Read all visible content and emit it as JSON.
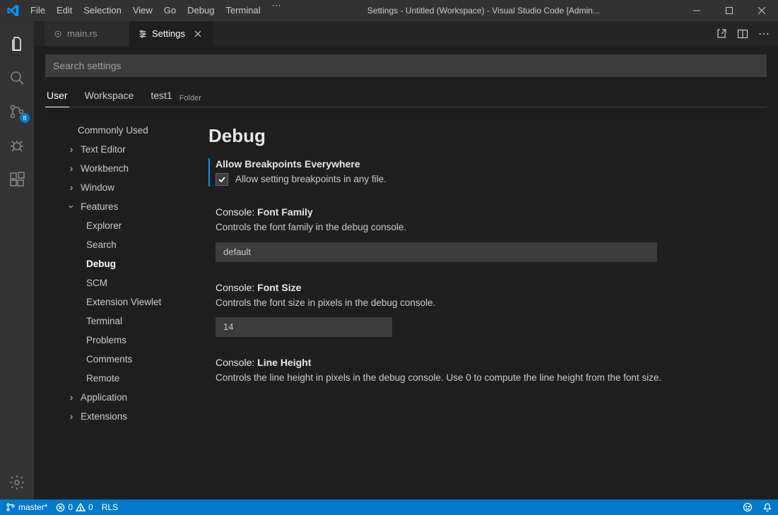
{
  "titlebar": {
    "menu": [
      "File",
      "Edit",
      "Selection",
      "View",
      "Go",
      "Debug",
      "Terminal"
    ],
    "title": "Settings - Untitled (Workspace) - Visual Studio Code [Admin..."
  },
  "activitybar": {
    "badge": "8"
  },
  "tabs": {
    "main": "main.rs",
    "settings": "Settings"
  },
  "search": {
    "placeholder": "Search settings"
  },
  "scope": {
    "user": "User",
    "workspace": "Workspace",
    "folder_name": "test1",
    "folder_label": "Folder"
  },
  "toc": {
    "commonly_used": "Commonly Used",
    "text_editor": "Text Editor",
    "workbench": "Workbench",
    "window": "Window",
    "features": "Features",
    "explorer": "Explorer",
    "search": "Search",
    "debug": "Debug",
    "scm": "SCM",
    "extension_viewlet": "Extension Viewlet",
    "terminal": "Terminal",
    "problems": "Problems",
    "comments": "Comments",
    "remote": "Remote",
    "application": "Application",
    "extensions": "Extensions"
  },
  "content": {
    "section": "Debug",
    "allow_bp": {
      "label": "Allow Breakpoints Everywhere",
      "desc": "Allow setting breakpoints in any file."
    },
    "font_family": {
      "scope": "Console: ",
      "name": "Font Family",
      "desc": "Controls the font family in the debug console.",
      "value": "default"
    },
    "font_size": {
      "scope": "Console: ",
      "name": "Font Size",
      "desc": "Controls the font size in pixels in the debug console.",
      "value": "14"
    },
    "line_height": {
      "scope": "Console: ",
      "name": "Line Height",
      "desc": "Controls the line height in pixels in the debug console. Use 0 to compute the line height from the font size."
    }
  },
  "status": {
    "branch": "master*",
    "errors": "0",
    "warnings": "0",
    "lang": "RLS"
  }
}
